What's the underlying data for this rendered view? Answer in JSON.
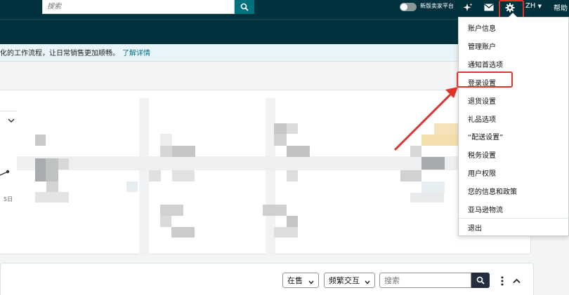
{
  "header": {
    "search_placeholder": "搜索",
    "toggle_label": "新版卖家平台",
    "language": "ZH",
    "help": "帮助"
  },
  "banner": {
    "text": "化的工作流程，让日常销售更加顺畅。",
    "link": "了解详情"
  },
  "card": {
    "day_label": "5日"
  },
  "toolbar": {
    "filter1": "在售",
    "filter2": "频繁交互",
    "search_placeholder": "搜索"
  },
  "settings_menu": {
    "items": [
      {
        "label": "账户信息"
      },
      {
        "label": "管理账户"
      },
      {
        "label": "通知首选项"
      },
      {
        "label": "登录设置"
      },
      {
        "label": "退货设置"
      },
      {
        "label": "礼品选项"
      },
      {
        "label": "“配送设置”"
      },
      {
        "label": "税务设置"
      },
      {
        "label": "用户权限"
      },
      {
        "label": "您的信息和政策"
      },
      {
        "label": "亚马逊物流"
      },
      {
        "label": "退出"
      }
    ],
    "highlighted": "登录设置"
  },
  "colors": {
    "topbar": "#00313c",
    "search_button": "#00727f",
    "highlight": "#e0342b",
    "link": "#007185"
  }
}
